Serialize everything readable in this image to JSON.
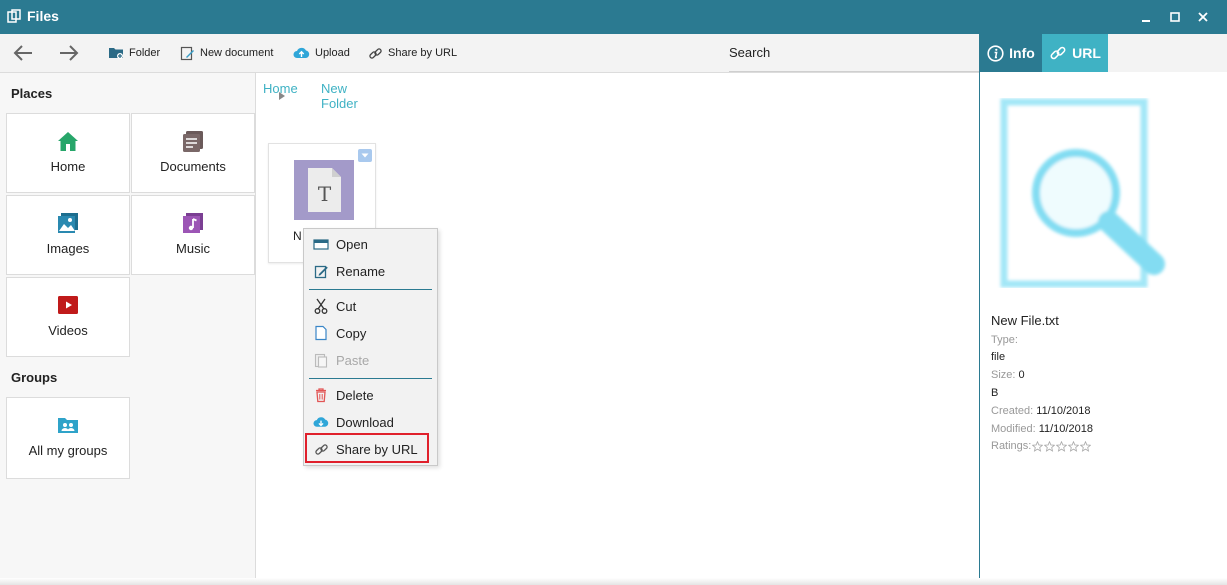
{
  "window": {
    "title": "Files"
  },
  "toolbar": {
    "folder_label": "Folder",
    "new_document_label": "New document",
    "upload_label": "Upload",
    "share_url_label": "Share by URL",
    "search_label": "Search"
  },
  "sidebar": {
    "places_title": "Places",
    "places": [
      {
        "label": "Home",
        "icon": "home-icon"
      },
      {
        "label": "Documents",
        "icon": "documents-icon"
      },
      {
        "label": "Images",
        "icon": "images-icon"
      },
      {
        "label": "Music",
        "icon": "music-icon"
      },
      {
        "label": "Videos",
        "icon": "videos-icon"
      }
    ],
    "groups_title": "Groups",
    "groups": [
      {
        "label": "All my groups",
        "icon": "groups-icon"
      }
    ]
  },
  "breadcrumb": {
    "home": "Home",
    "current_line1": "New",
    "current_line2": "Folder"
  },
  "file": {
    "name_partial": "N",
    "thumb_letter": "T"
  },
  "context_menu": {
    "open": "Open",
    "rename": "Rename",
    "cut": "Cut",
    "copy": "Copy",
    "paste": "Paste",
    "delete": "Delete",
    "download": "Download",
    "share_url": "Share by URL"
  },
  "right_panel": {
    "tab_info": "Info",
    "tab_url": "URL",
    "file_name": "New File.txt",
    "type_label": "Type:",
    "type_value": "file",
    "size_label": "Size:",
    "size_value": "0",
    "size_unit": "B",
    "created_label": "Created:",
    "created_value": "11/10/2018",
    "modified_label": "Modified:",
    "modified_value": "11/10/2018",
    "ratings_label": "Ratings:",
    "rating": 0,
    "rating_max": 5
  },
  "colors": {
    "titlebar": "#2b7a91",
    "accent": "#3fb2c4",
    "highlight": "#e0202c"
  }
}
